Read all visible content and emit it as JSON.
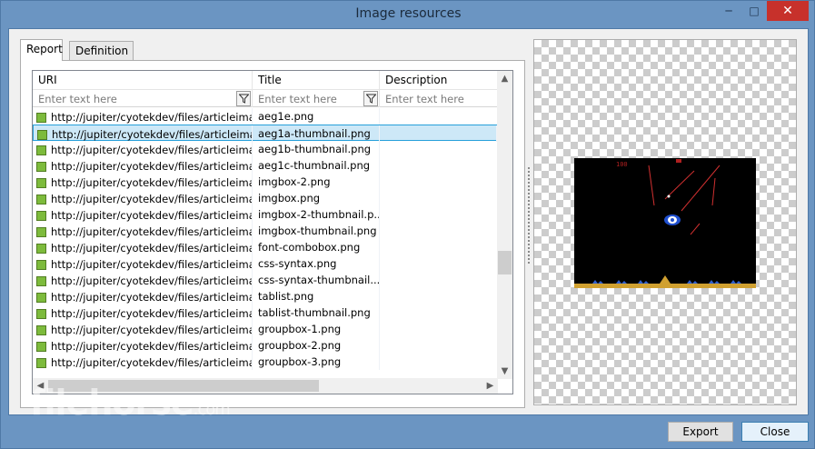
{
  "window": {
    "title": "Image resources",
    "minimize_glyph": "─",
    "maximize_glyph": "□",
    "close_glyph": "✕"
  },
  "tabs": [
    {
      "label": "Report",
      "active": true
    },
    {
      "label": "Definition",
      "active": false
    }
  ],
  "grid": {
    "columns": [
      "URI",
      "Title",
      "Description"
    ],
    "filter_placeholder": "Enter text here",
    "rows": [
      {
        "uri": "http://jupiter/cyotekdev/files/articleima...",
        "title": "aeg1e.png",
        "selected": false
      },
      {
        "uri": "http://jupiter/cyotekdev/files/articleima...",
        "title": "aeg1a-thumbnail.png",
        "selected": true
      },
      {
        "uri": "http://jupiter/cyotekdev/files/articleima...",
        "title": "aeg1b-thumbnail.png",
        "selected": false
      },
      {
        "uri": "http://jupiter/cyotekdev/files/articleima...",
        "title": "aeg1c-thumbnail.png",
        "selected": false
      },
      {
        "uri": "http://jupiter/cyotekdev/files/articleima...",
        "title": "imgbox-2.png",
        "selected": false
      },
      {
        "uri": "http://jupiter/cyotekdev/files/articleima...",
        "title": "imgbox.png",
        "selected": false
      },
      {
        "uri": "http://jupiter/cyotekdev/files/articleima...",
        "title": "imgbox-2-thumbnail.p...",
        "selected": false
      },
      {
        "uri": "http://jupiter/cyotekdev/files/articleima...",
        "title": "imgbox-thumbnail.png",
        "selected": false
      },
      {
        "uri": "http://jupiter/cyotekdev/files/articleima...",
        "title": "font-combobox.png",
        "selected": false
      },
      {
        "uri": "http://jupiter/cyotekdev/files/articleima...",
        "title": "css-syntax.png",
        "selected": false
      },
      {
        "uri": "http://jupiter/cyotekdev/files/articleima...",
        "title": "css-syntax-thumbnail....",
        "selected": false
      },
      {
        "uri": "http://jupiter/cyotekdev/files/articleima...",
        "title": "tablist.png",
        "selected": false
      },
      {
        "uri": "http://jupiter/cyotekdev/files/articleima...",
        "title": "tablist-thumbnail.png",
        "selected": false
      },
      {
        "uri": "http://jupiter/cyotekdev/files/articleima...",
        "title": "groupbox-1.png",
        "selected": false
      },
      {
        "uri": "http://jupiter/cyotekdev/files/articleima...",
        "title": "groupbox-2.png",
        "selected": false
      },
      {
        "uri": "http://jupiter/cyotekdev/files/articleima...",
        "title": "groupbox-3.png",
        "selected": false
      }
    ]
  },
  "preview": {
    "score": "100"
  },
  "buttons": {
    "export": "Export",
    "close": "Close"
  },
  "watermark": {
    "brand": "filehorse",
    "suffix": ".com"
  },
  "colors": {
    "window_frame": "#6b95c2",
    "selection": "#cde8f7",
    "close_button": "#c7312b",
    "row_icon": "#7dbb3c"
  }
}
